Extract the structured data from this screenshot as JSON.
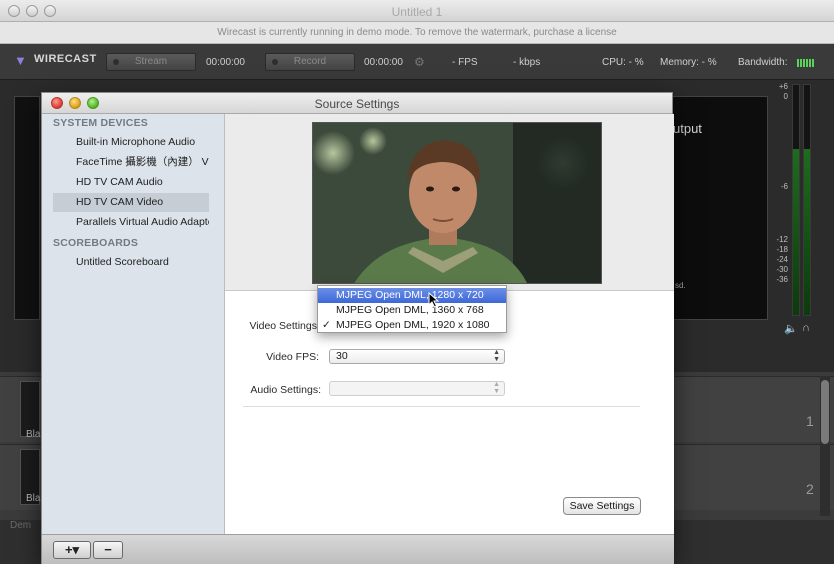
{
  "app": {
    "window_title": "Untitled 1",
    "demo_banner": "Wirecast is currently running in demo mode. To remove the watermark, purchase a license",
    "logo": "WIRECAST"
  },
  "toolbar": {
    "stream_label": "Stream",
    "stream_time": "00:00:00",
    "record_label": "Record",
    "record_time": "00:00:00",
    "fps": "- FPS",
    "kbps": "- kbps",
    "cpu": "CPU: - %",
    "memory": "Memory: - %",
    "bandwidth": "Bandwidth:",
    "bandwidth_color": "#5ad25a"
  },
  "background": {
    "output_label": "utput",
    "meter_scale": [
      "+6",
      "0",
      "-6",
      "-12",
      "-18",
      "-24",
      "-30",
      "-36"
    ],
    "sd_fragment": "sd.",
    "layer_numbers": [
      "1",
      "2"
    ],
    "row_label": "Bla",
    "demo_fragment": "Dem"
  },
  "dialog": {
    "title": "Source Settings",
    "sidebar": {
      "system_devices_header": "SYSTEM DEVICES",
      "items": [
        {
          "label": "Built-in Microphone Audio"
        },
        {
          "label": "FaceTime 攝影機（內建） Vid"
        },
        {
          "label": "HD TV CAM Audio"
        },
        {
          "label": "HD TV CAM Video"
        },
        {
          "label": "Parallels Virtual Audio Adapter"
        }
      ],
      "scoreboards_header": "SCOREBOARDS",
      "scoreboard_items": [
        {
          "label": "Untitled Scoreboard"
        }
      ]
    },
    "form": {
      "video_settings_label": "Video Settings",
      "video_fps_label": "Video FPS:",
      "video_fps_value": "30",
      "audio_settings_label": "Audio Settings:",
      "audio_settings_value": ""
    },
    "video_settings_menu": {
      "options": [
        {
          "label": "MJPEG Open DML, 1280 x 720",
          "highlighted": true,
          "checked": false
        },
        {
          "label": "MJPEG Open DML, 1360 x 768",
          "highlighted": false,
          "checked": false
        },
        {
          "label": "MJPEG Open DML, 1920 x 1080",
          "highlighted": false,
          "checked": true
        }
      ],
      "check_mark": "✓"
    },
    "save_button": "Save Settings",
    "add_button": "+▾",
    "remove_button": "−"
  },
  "colors": {
    "selection": "#3d68d8",
    "sidebar_bg": "#dde3ea"
  }
}
